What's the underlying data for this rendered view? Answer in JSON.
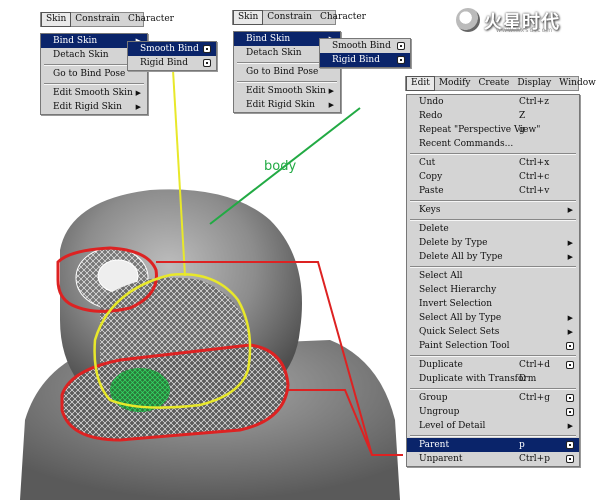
{
  "logo": {
    "text": "火星时代",
    "url": "www.hxsd.com"
  },
  "annotation": {
    "label": "body",
    "label_color": "#22aa44",
    "line_green": "#22aa44",
    "line_yellow": "#e8e82a",
    "line_red": "#dd2222"
  },
  "skin_menu_1": {
    "menubar": [
      "Skin",
      "Constrain",
      "Character"
    ],
    "items": [
      {
        "label": "Bind Skin",
        "submenu": true,
        "selected": true
      },
      {
        "label": "Detach Skin"
      },
      {
        "sep": true
      },
      {
        "label": "Go to Bind Pose"
      },
      {
        "sep": true
      },
      {
        "label": "Edit Smooth Skin",
        "submenu": true
      },
      {
        "label": "Edit Rigid Skin",
        "submenu": true
      }
    ],
    "submenu": [
      {
        "label": "Smooth Bind",
        "selected": true,
        "option": true
      },
      {
        "label": "Rigid Bind",
        "option": true
      }
    ]
  },
  "skin_menu_2": {
    "menubar": [
      "Skin",
      "Constrain",
      "Character"
    ],
    "items": [
      {
        "label": "Bind Skin",
        "submenu": true,
        "selected": true
      },
      {
        "label": "Detach Skin"
      },
      {
        "sep": true
      },
      {
        "label": "Go to Bind Pose"
      },
      {
        "sep": true
      },
      {
        "label": "Edit Smooth Skin",
        "submenu": true
      },
      {
        "label": "Edit Rigid Skin",
        "submenu": true
      }
    ],
    "submenu": [
      {
        "label": "Smooth Bind",
        "option": true
      },
      {
        "label": "Rigid Bind",
        "selected": true,
        "option": true
      }
    ]
  },
  "edit_menu": {
    "menubar": [
      "Edit",
      "Modify",
      "Create",
      "Display",
      "Window"
    ],
    "items": [
      {
        "label": "Undo",
        "shortcut": "Ctrl+z"
      },
      {
        "label": "Redo",
        "shortcut": "Z"
      },
      {
        "label": "Repeat \"Perspective View\"",
        "shortcut": "g"
      },
      {
        "label": "Recent Commands..."
      },
      {
        "sep": true
      },
      {
        "label": "Cut",
        "shortcut": "Ctrl+x"
      },
      {
        "label": "Copy",
        "shortcut": "Ctrl+c"
      },
      {
        "label": "Paste",
        "shortcut": "Ctrl+v"
      },
      {
        "sep": true
      },
      {
        "label": "Keys",
        "submenu": true
      },
      {
        "sep": true
      },
      {
        "label": "Delete"
      },
      {
        "label": "Delete by Type",
        "submenu": true
      },
      {
        "label": "Delete All by Type",
        "submenu": true
      },
      {
        "sep": true
      },
      {
        "label": "Select All"
      },
      {
        "label": "Select Hierarchy"
      },
      {
        "label": "Invert Selection"
      },
      {
        "label": "Select All by Type",
        "submenu": true
      },
      {
        "label": "Quick Select Sets",
        "submenu": true
      },
      {
        "label": "Paint Selection Tool",
        "option": true
      },
      {
        "sep": true
      },
      {
        "label": "Duplicate",
        "shortcut": "Ctrl+d",
        "option": true
      },
      {
        "label": "Duplicate with Transform",
        "shortcut": "D"
      },
      {
        "sep": true
      },
      {
        "label": "Group",
        "shortcut": "Ctrl+g",
        "option": true
      },
      {
        "label": "Ungroup",
        "option": true
      },
      {
        "label": "Level of Detail",
        "submenu": true
      },
      {
        "sep": true
      },
      {
        "label": "Parent",
        "shortcut": "p",
        "option": true,
        "selected": true
      },
      {
        "label": "Unparent",
        "shortcut": "Ctrl+p",
        "option": true
      }
    ]
  }
}
